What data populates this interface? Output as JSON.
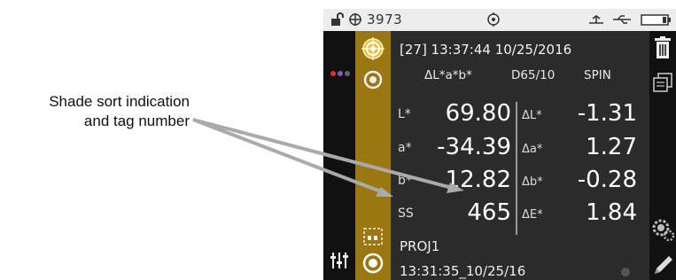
{
  "callout": {
    "line1": "Shade sort indication",
    "line2": "and tag number"
  },
  "status_bar": {
    "device_id": "3973",
    "icons": [
      "unlock-icon",
      "target-icon",
      "settings-dial-icon",
      "bluetooth-icon",
      "usb-icon",
      "battery-icon"
    ]
  },
  "header": {
    "sample": "[27] 13:37:44 10/25/2016",
    "mode": "ΔL*a*b*",
    "illuminant": "D65/10",
    "spec": "SPIN"
  },
  "measurements": [
    {
      "label": "L*",
      "value": "69.80",
      "delta_label": "ΔL*",
      "delta_value": "-1.31"
    },
    {
      "label": "a*",
      "value": "-34.39",
      "delta_label": "Δa*",
      "delta_value": "1.27"
    },
    {
      "label": "b*",
      "value": "12.82",
      "delta_label": "Δb*",
      "delta_value": "-0.28"
    },
    {
      "label": "SS",
      "value": "465",
      "delta_label": "ΔE*",
      "delta_value": "1.84"
    }
  ],
  "footer": {
    "project": "PROJ1",
    "timestamp": "13:31:35_10/25/16"
  },
  "colors": {
    "accent_gold": "#9b7712",
    "panel_bg": "#2b2b2b",
    "dot_red": "#d9342b",
    "dot_purple": "#8a5ab8",
    "dot_grey": "#666666"
  }
}
